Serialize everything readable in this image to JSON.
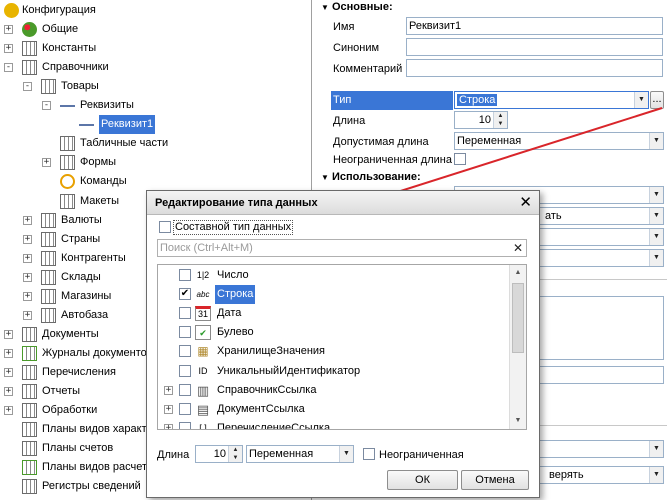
{
  "tree": {
    "items": [
      {
        "label": "Конфигурация",
        "pm": "",
        "icon": "config-icon",
        "color": "#e8b400",
        "selected": false
      },
      {
        "label": "Общие",
        "pm": "+",
        "icon": "common-icon",
        "color": "#4a9a2a",
        "selected": false
      },
      {
        "label": "Константы",
        "pm": "+",
        "icon": "constants-icon",
        "color": "#6b6b6b",
        "selected": false
      },
      {
        "label": "Справочники",
        "pm": "-",
        "icon": "catalog-icon",
        "color": "#6b6b6b",
        "selected": false
      },
      {
        "label": "Товары",
        "pm": "-",
        "icon": "catalog-icon",
        "color": "#6b6b6b",
        "selected": false
      },
      {
        "label": "Реквизиты",
        "pm": "-",
        "icon": "attributes-icon",
        "color": "#5c76a8",
        "selected": false
      },
      {
        "label": "Реквизит1",
        "pm": "",
        "icon": "attribute-icon",
        "color": "#5c76a8",
        "selected": true
      },
      {
        "label": "Табличные части",
        "pm": "",
        "icon": "tabular-section-icon",
        "color": "#6b6b6b",
        "selected": false
      },
      {
        "label": "Формы",
        "pm": "+",
        "icon": "form-icon",
        "color": "#6b6b6b",
        "selected": false
      },
      {
        "label": "Команды",
        "pm": "",
        "icon": "command-icon",
        "color": "#e8a000",
        "selected": false
      },
      {
        "label": "Макеты",
        "pm": "",
        "icon": "template-icon",
        "color": "#6b6b6b",
        "selected": false
      },
      {
        "label": "Валюты",
        "pm": "+",
        "icon": "catalog-icon",
        "color": "#6b6b6b",
        "selected": false
      },
      {
        "label": "Страны",
        "pm": "+",
        "icon": "catalog-icon",
        "color": "#6b6b6b",
        "selected": false
      },
      {
        "label": "Контрагенты",
        "pm": "+",
        "icon": "catalog-icon",
        "color": "#6b6b6b",
        "selected": false
      },
      {
        "label": "Склады",
        "pm": "+",
        "icon": "catalog-icon",
        "color": "#6b6b6b",
        "selected": false
      },
      {
        "label": "Магазины",
        "pm": "+",
        "icon": "catalog-icon",
        "color": "#6b6b6b",
        "selected": false
      },
      {
        "label": "Автобаза",
        "pm": "+",
        "icon": "catalog-icon",
        "color": "#6b6b6b",
        "selected": false
      },
      {
        "label": "Документы",
        "pm": "+",
        "icon": "document-icon",
        "color": "#6b6b6b",
        "selected": false
      },
      {
        "label": "Журналы документов",
        "pm": "+",
        "icon": "journal-icon",
        "color": "#4a9a2a",
        "selected": false
      },
      {
        "label": "Перечисления",
        "pm": "+",
        "icon": "enum-icon",
        "color": "#6b6b6b",
        "selected": false
      },
      {
        "label": "Отчеты",
        "pm": "+",
        "icon": "report-icon",
        "color": "#6b6b6b",
        "selected": false
      },
      {
        "label": "Обработки",
        "pm": "+",
        "icon": "processing-icon",
        "color": "#6b6b6b",
        "selected": false
      },
      {
        "label": "Планы видов характеристик",
        "pm": "",
        "icon": "chart-of-characteristics-icon",
        "color": "#6b6b6b",
        "selected": false
      },
      {
        "label": "Планы счетов",
        "pm": "",
        "icon": "chart-of-accounts-icon",
        "color": "#6b6b6b",
        "selected": false
      },
      {
        "label": "Планы видов расчета",
        "pm": "",
        "icon": "calculation-types-icon",
        "color": "#4a9a2a",
        "selected": false
      },
      {
        "label": "Регистры сведений",
        "pm": "",
        "icon": "info-register-icon",
        "color": "#6b6b6b",
        "selected": false
      }
    ]
  },
  "props": {
    "basic_section": "Основные:",
    "name_label": "Имя",
    "name_value": "Реквизит1",
    "synonym_label": "Синоним",
    "synonym_value": "",
    "comment_label": "Комментарий",
    "comment_value": "",
    "type_label": "Тип",
    "type_value": "Строка",
    "type_more": "...",
    "length_label": "Длина",
    "length_value": "10",
    "allowed_length_label": "Допустимая длина",
    "allowed_length_value": "Переменная",
    "unlimited_length_label": "Неограниченная длина",
    "usage_section": "Использование:",
    "partial_value_1": "ать",
    "partial_value_2": "верять"
  },
  "dialog": {
    "title": "Редактирование типа данных",
    "composite_label": "Составной тип данных",
    "search_placeholder": "Поиск (Ctrl+Alt+M)",
    "types": [
      {
        "label": "Число",
        "icon": "number-type-icon",
        "glyph": "1|2",
        "checked": false,
        "selected": false,
        "pm": ""
      },
      {
        "label": "Строка",
        "icon": "string-type-icon",
        "glyph": "abc",
        "checked": true,
        "selected": true,
        "pm": ""
      },
      {
        "label": "Дата",
        "icon": "date-type-icon",
        "glyph": "31",
        "checked": false,
        "selected": false,
        "pm": ""
      },
      {
        "label": "Булево",
        "icon": "boolean-type-icon",
        "glyph": "✔",
        "checked": false,
        "selected": false,
        "pm": ""
      },
      {
        "label": "ХранилищеЗначения",
        "icon": "value-storage-icon",
        "glyph": "▦",
        "checked": false,
        "selected": false,
        "pm": ""
      },
      {
        "label": "УникальныйИдентификатор",
        "icon": "uuid-icon",
        "glyph": "ID",
        "checked": false,
        "selected": false,
        "pm": ""
      },
      {
        "label": "СправочникСсылка",
        "icon": "catalog-ref-icon",
        "glyph": "▥",
        "checked": false,
        "selected": false,
        "pm": "+"
      },
      {
        "label": "ДокументСсылка",
        "icon": "document-ref-icon",
        "glyph": "▤",
        "checked": false,
        "selected": false,
        "pm": "+"
      },
      {
        "label": "ПеречислениеСсылка",
        "icon": "enum-ref-icon",
        "glyph": "[ ]",
        "checked": false,
        "selected": false,
        "pm": "+"
      }
    ],
    "length_label": "Длина",
    "length_value": "10",
    "allowed_length_value": "Переменная",
    "unlimited_label": "Неограниченная",
    "ok_label": "ОК",
    "cancel_label": "Отмена"
  },
  "colors": {
    "selection": "#3a76d6",
    "arrow": "#d9252a"
  }
}
